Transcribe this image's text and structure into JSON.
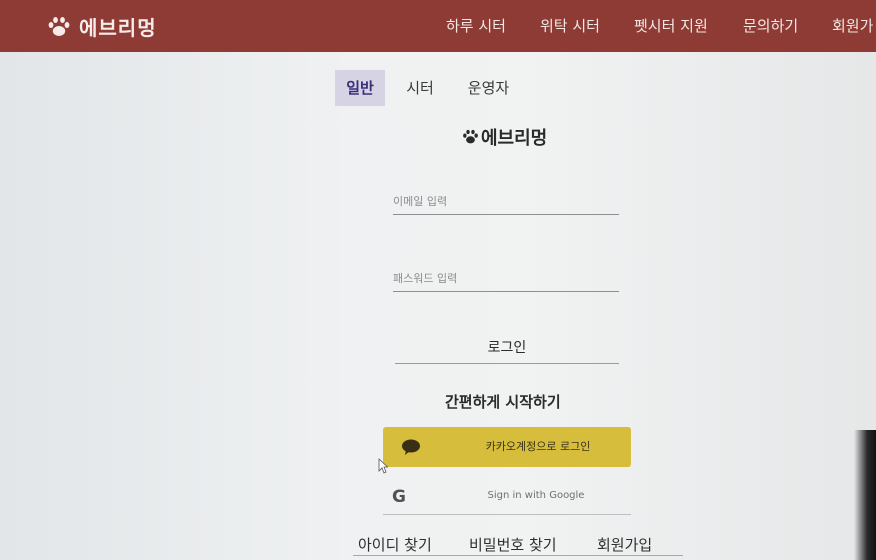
{
  "header": {
    "logo_text": "에브리멍",
    "logo_icon": "paw-icon",
    "nav": [
      "하루 시터",
      "위탁 시터",
      "펫시터 지원",
      "문의하기",
      "회원가"
    ]
  },
  "tabs": {
    "items": [
      "일반",
      "시터",
      "운영자"
    ],
    "active": "일반"
  },
  "brand": {
    "text": "에브리멍",
    "icon": "paw-icon"
  },
  "form": {
    "email_placeholder": "이메일 입력",
    "password_placeholder": "패스워드 입력",
    "login_label": "로그인"
  },
  "social": {
    "heading": "간편하게 시작하기",
    "kakao_label": "카카오계정으로 로그인",
    "kakao_icon": "chat-bubble-icon",
    "google_label": "Sign in with Google",
    "google_icon": "G"
  },
  "links": [
    "아이디 찾기",
    "비밀번호 찾기",
    "회원가입"
  ],
  "colors": {
    "header_bg": "#8e3b35",
    "kakao": "#d6bd3c",
    "active_tab_bg": "#d5d3e4"
  }
}
